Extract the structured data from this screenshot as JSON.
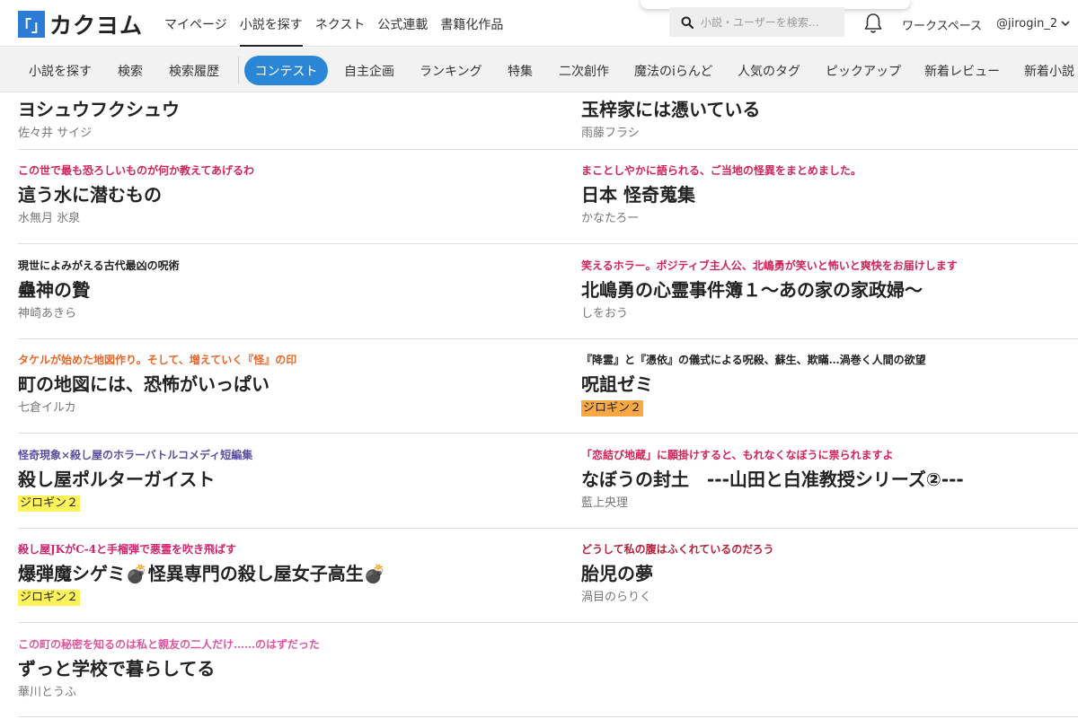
{
  "header": {
    "logo_mark": "「」",
    "logo_text": "カクヨム",
    "nav": [
      "マイページ",
      "小説を探す",
      "ネクスト",
      "公式連載",
      "書籍化作品"
    ],
    "search_placeholder": "小説・ユーザーを検索…",
    "workspace": "ワークスペース",
    "user": "@jirogin_2"
  },
  "subnav": {
    "items_before": [
      "小説を探す",
      "検索",
      "検索履歴"
    ],
    "active": "コンテスト",
    "items_after": [
      "自主企画",
      "ランキング",
      "特集",
      "二次創作",
      "魔法のiらんど",
      "人気のタグ",
      "ピックアップ",
      "新着レビュー",
      "新着小説"
    ]
  },
  "works": {
    "left": [
      {
        "catch": "",
        "title": "ヨシュウフクシュウ",
        "author": "佐々井 サイジ",
        "catch_color": "#222222",
        "highlight": ""
      },
      {
        "catch": "この世で最も恐ろしいものが何か教えてあげるわ",
        "title": "這う水に潜むもの",
        "author": "水無月 氷泉",
        "catch_color": "#d2245a",
        "highlight": ""
      },
      {
        "catch": "現世によみがえる古代最凶の呪術",
        "title": "蠱神の贄",
        "author": "神崎あきら",
        "catch_color": "#222222",
        "highlight": ""
      },
      {
        "catch": "タケルが始めた地図作り。そして、増えていく『怪』の印",
        "title": "町の地図には、恐怖がいっぱい",
        "author": "七倉イルカ",
        "catch_color": "#e8662a",
        "highlight": ""
      },
      {
        "catch": "怪奇現象×殺し屋のホラーバトルコメディ短編集",
        "title": "殺し屋ポルターガイスト",
        "author": "ジロギン２",
        "catch_color": "#5a4fa0",
        "highlight": "yellow"
      },
      {
        "catch": "殺し屋JKがC-4と手榴弾で悪霊を吹き飛ばす",
        "title": "爆弾魔シゲミ💣怪異専門の殺し屋女子高生💣",
        "author": "ジロギン２",
        "catch_color": "#d2246e",
        "highlight": "yellow"
      },
      {
        "catch": "この町の秘密を知るのは私と親友の二人だけ……のはずだった",
        "title": "ずっと学校で暮らしてる",
        "author": "華川とうふ",
        "catch_color": "#e0569e",
        "highlight": ""
      }
    ],
    "right": [
      {
        "catch": "",
        "title": "玉梓家には憑いている",
        "author": "雨藤フラシ",
        "catch_color": "#222222",
        "highlight": ""
      },
      {
        "catch": "まことしやかに語られる、ご当地の怪異をまとめました。",
        "title": "日本 怪奇蒐集",
        "author": "かなたろー",
        "catch_color": "#d2245a",
        "highlight": ""
      },
      {
        "catch": "笑えるホラー。ポジティブ主人公、北嶋勇が笑いと怖いと爽快をお届けします",
        "title": "北嶋勇の心霊事件簿１～あの家の家政婦～",
        "author": "しをおう",
        "catch_color": "#d2245a",
        "highlight": ""
      },
      {
        "catch": "『降霊』と『憑依』の儀式による呪殺、蘇生、欺瞞…渦巻く人間の欲望",
        "title": "呪詛ゼミ",
        "author": "ジロギン２",
        "catch_color": "#222222",
        "highlight": "orange"
      },
      {
        "catch": "「恋結び地蔵」に願掛けすると、もれなくなぼうに祟られますよ",
        "title": "なぼうの封土　---山田と白准教授シリーズ②---",
        "author": "藍上央理",
        "catch_color": "#d2245a",
        "highlight": ""
      },
      {
        "catch": "どうして私の腹はふくれているのだろう",
        "title": "胎児の夢",
        "author": "渦目のらりく",
        "catch_color": "#b5213a",
        "highlight": ""
      }
    ]
  },
  "colors": {
    "accent": "#2c86d6",
    "logo": "#2c7bd4",
    "author_highlight_yellow": "#fff35c",
    "author_highlight_orange": "#f7a845"
  }
}
